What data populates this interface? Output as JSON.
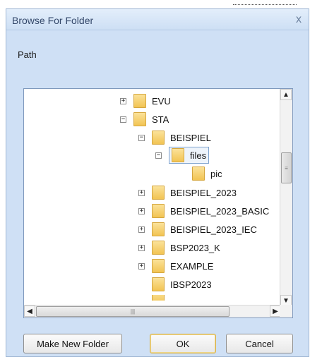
{
  "dialog": {
    "title": "Browse For Folder",
    "close_glyph": "x",
    "path_label": "Path"
  },
  "tree": {
    "items": [
      {
        "label": "EVU",
        "expander": "+"
      },
      {
        "label": "STA",
        "expander": "−"
      },
      {
        "label": "BEISPIEL",
        "expander": "−"
      },
      {
        "label": "files",
        "expander": "−",
        "selected": true
      },
      {
        "label": "pic",
        "expander": ""
      },
      {
        "label": "BEISPIEL_2023",
        "expander": "+"
      },
      {
        "label": "BEISPIEL_2023_BASIC",
        "expander": "+"
      },
      {
        "label": "BEISPIEL_2023_IEC",
        "expander": "+"
      },
      {
        "label": "BSP2023_K",
        "expander": "+"
      },
      {
        "label": "EXAMPLE",
        "expander": "+"
      },
      {
        "label": "IBSP2023",
        "expander": ""
      }
    ],
    "scroll_up": "▲",
    "scroll_down": "▼",
    "scroll_left": "◀",
    "scroll_right": "▶",
    "vgrip": "≡",
    "hgrip": "|||"
  },
  "buttons": {
    "make_new_folder": "Make New Folder",
    "ok": "OK",
    "cancel": "Cancel"
  },
  "colors": {
    "dialog_bg": "#cfe0f5",
    "folder": "#f2c453",
    "title_text": "#34486a"
  },
  "icons": [
    "folder-icon",
    "plus-expander-icon",
    "minus-expander-icon",
    "close-icon"
  ]
}
